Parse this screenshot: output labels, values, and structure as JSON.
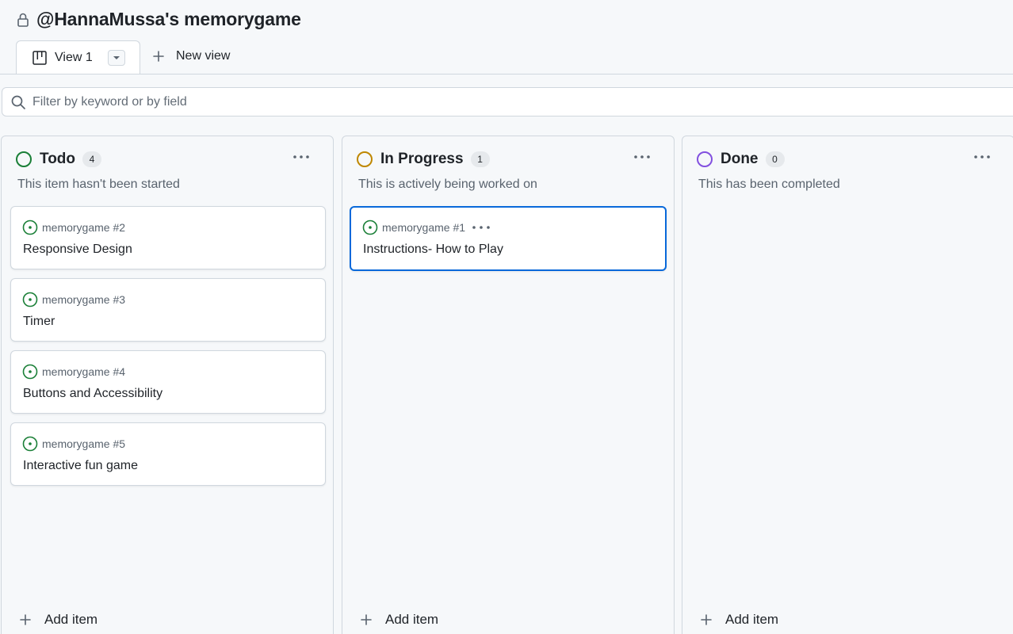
{
  "header": {
    "title": "@HannaMussa's memorygame",
    "lock_icon": "lock-icon"
  },
  "tabs": {
    "active": {
      "label": "View 1",
      "icon": "board-icon",
      "caret_icon": "triangle-down-icon"
    },
    "new_view_label": "New view"
  },
  "filter": {
    "placeholder": "Filter by keyword or by field",
    "value": ""
  },
  "columns": [
    {
      "name": "Todo",
      "count": "4",
      "description": "This item hasn't been started",
      "color": "#1a7f37",
      "cards": [
        {
          "ref": "memorygame #2",
          "title": "Responsive Design"
        },
        {
          "ref": "memorygame #3",
          "title": "Timer"
        },
        {
          "ref": "memorygame #4",
          "title": "Buttons and Accessibility"
        },
        {
          "ref": "memorygame #5",
          "title": "Interactive fun game"
        }
      ],
      "add_label": "Add item"
    },
    {
      "name": "In Progress",
      "count": "1",
      "description": "This is actively being worked on",
      "color": "#bf8700",
      "cards": [
        {
          "ref": "memorygame #1",
          "title": "Instructions- How to Play",
          "selected": true
        }
      ],
      "add_label": "Add item"
    },
    {
      "name": "Done",
      "count": "0",
      "description": "This has been completed",
      "color": "#8250df",
      "cards": [],
      "add_label": "Add item"
    }
  ],
  "colors": {
    "issue_open": "#1a7f37",
    "accent": "#0969da",
    "border": "#d0d7de",
    "background": "#f6f8fa"
  }
}
